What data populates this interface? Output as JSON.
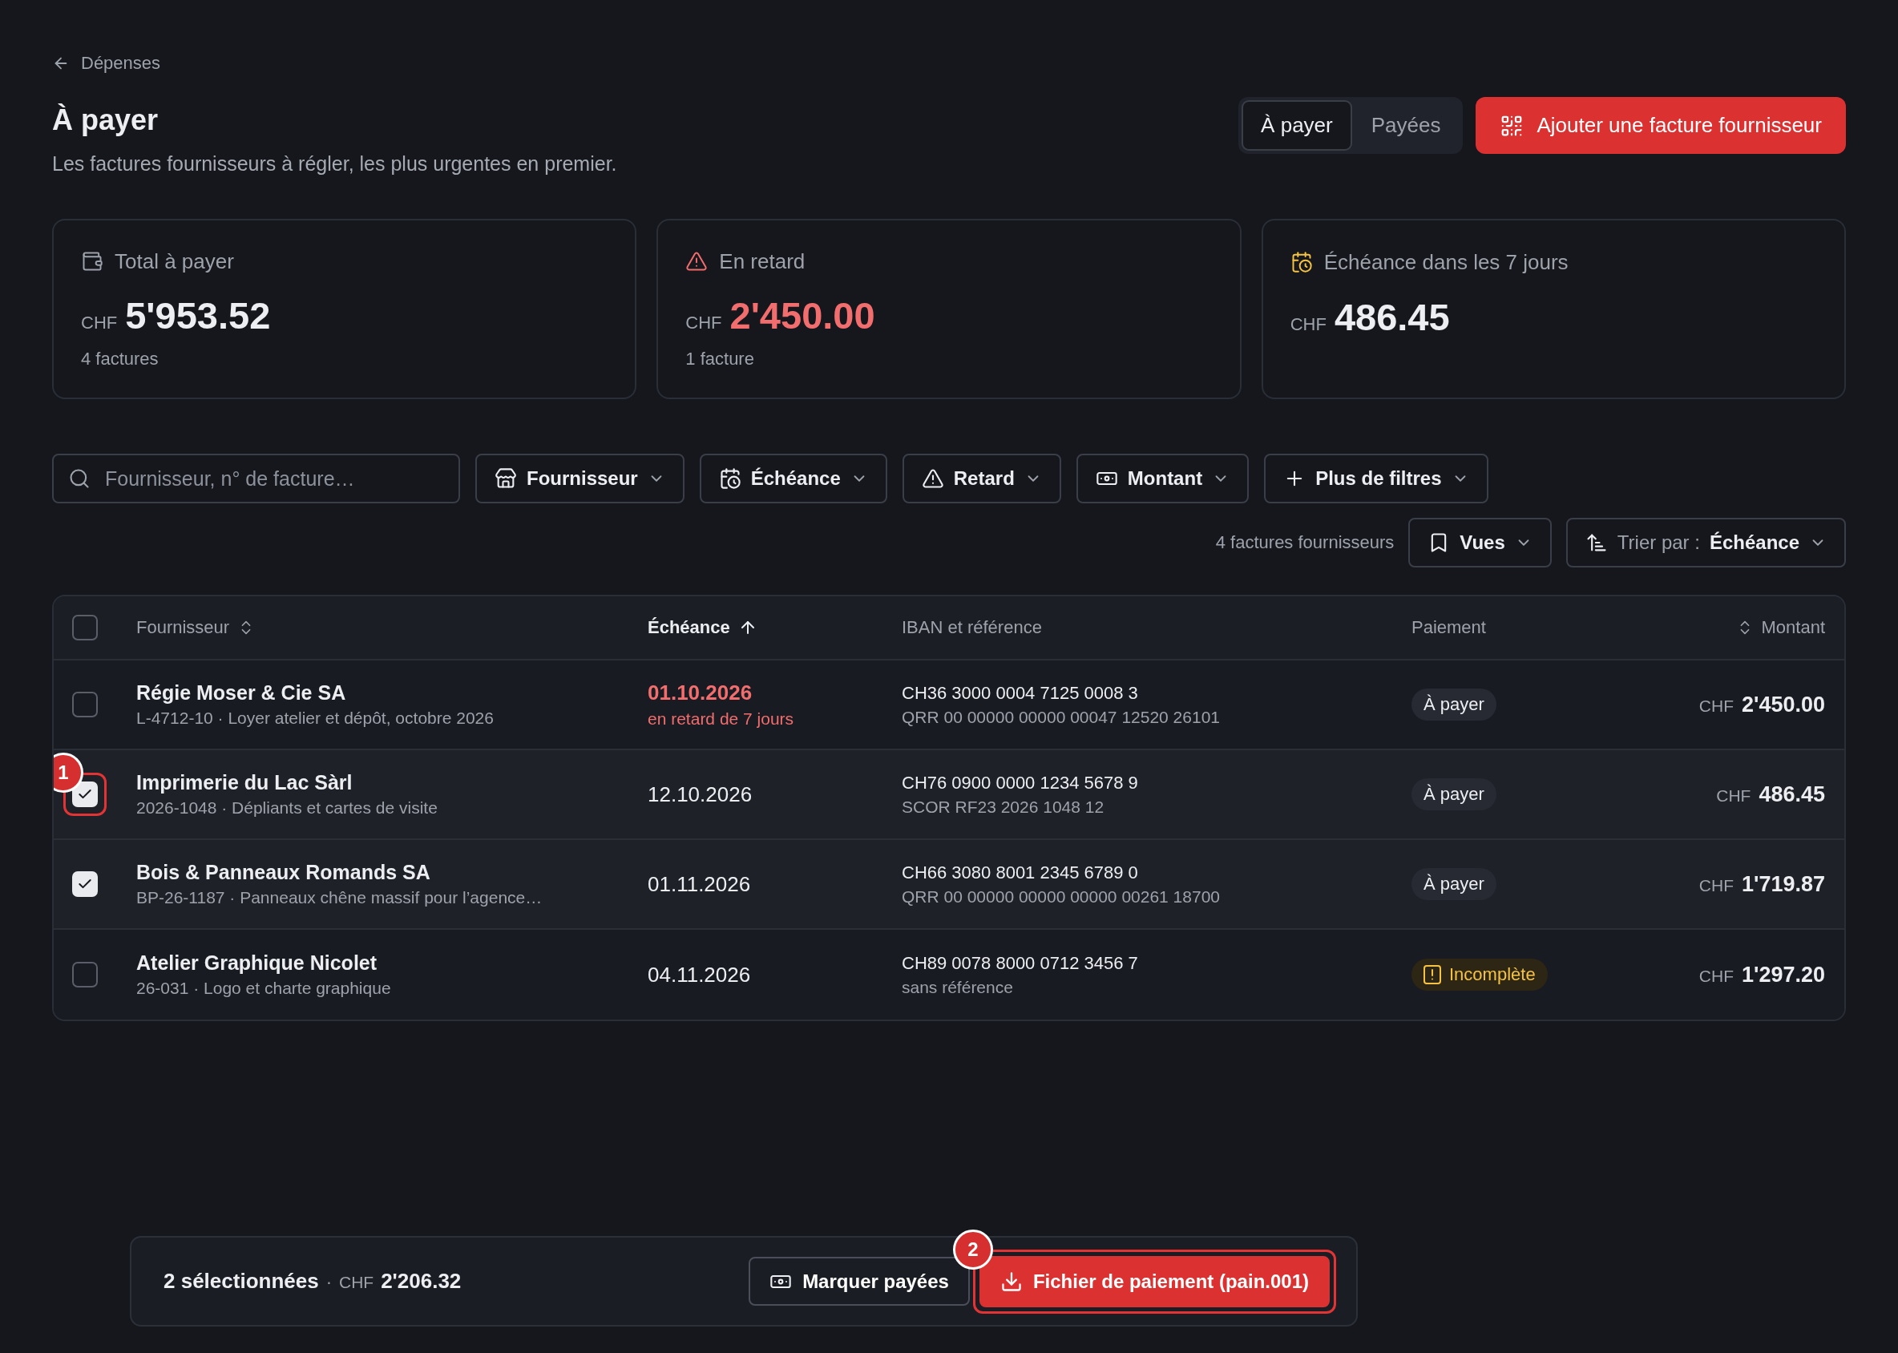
{
  "breadcrumb": {
    "label": "Dépenses"
  },
  "header": {
    "title": "À payer",
    "subtitle": "Les factures fournisseurs à régler, les plus urgentes en premier."
  },
  "view_tabs": [
    {
      "label": "À payer",
      "selected": true
    },
    {
      "label": "Payées",
      "selected": false
    }
  ],
  "primary_action": {
    "label": "Ajouter une facture fournisseur"
  },
  "stats": [
    {
      "kind": "total",
      "label": "Total à payer",
      "currency": "CHF",
      "value": "5'953.52",
      "note": "4 factures"
    },
    {
      "kind": "overdue",
      "label": "En retard",
      "currency": "CHF",
      "value": "2'450.00",
      "note": "1 facture"
    },
    {
      "kind": "due_soon",
      "label": "Échéance dans les 7 jours",
      "currency": "CHF",
      "value": "486.45"
    }
  ],
  "filters": {
    "search": {
      "placeholder": "Fournisseur, n° de facture…"
    },
    "dropdowns": [
      {
        "kind": "supplier",
        "label": "Fournisseur"
      },
      {
        "kind": "due_date",
        "label": "Échéance"
      },
      {
        "kind": "overdue",
        "label": "Retard"
      },
      {
        "kind": "amount",
        "label": "Montant"
      },
      {
        "kind": "more",
        "label": "Plus de filtres"
      }
    ]
  },
  "results": {
    "count": "4 factures fournisseurs",
    "views": {
      "label": "Vues"
    },
    "sort": {
      "label": "Trier par :",
      "value": "Échéance"
    }
  },
  "table": {
    "header_checkbox": {
      "checked": false
    },
    "columns": [
      {
        "label": "Fournisseur",
        "sortable": true,
        "sorted": false
      },
      {
        "label": "Échéance",
        "sortable": true,
        "sorted": true
      },
      {
        "label": "IBAN et référence",
        "sortable": false,
        "sorted": false
      },
      {
        "label": "Paiement",
        "sortable": false,
        "sorted": false
      },
      {
        "label": "Montant",
        "sortable": true,
        "sorted": false
      }
    ],
    "rows": [
      {
        "selected": false,
        "supplier": "Régie Moser & Cie SA",
        "details": "L-4712-10 · Loyer atelier et dépôt, octobre 2026",
        "due_date": "01.10.2026",
        "overdue": true,
        "overdue_note": "en retard de 7 jours",
        "iban": "CH36 3000 0004 7125 0008 3",
        "reference": "QRR 00 00000 00000 00047 12520 26101",
        "status": {
          "kind": "to_pay",
          "label": "À payer"
        },
        "currency": "CHF",
        "amount": "2'450.00"
      },
      {
        "selected": true,
        "callout": "1",
        "supplier": "Imprimerie du Lac Sàrl",
        "details": "2026-1048 · Dépliants et cartes de visite",
        "due_date": "12.10.2026",
        "overdue": false,
        "iban": "CH76 0900 0000 1234 5678 9",
        "reference": "SCOR RF23 2026 1048 12",
        "status": {
          "kind": "to_pay",
          "label": "À payer"
        },
        "currency": "CHF",
        "amount": "486.45"
      },
      {
        "selected": true,
        "supplier": "Bois & Panneaux Romands SA",
        "details": "BP-26-1187 · Panneaux chêne massif pour l’agence…",
        "due_date": "01.11.2026",
        "overdue": false,
        "iban": "CH66 3080 8001 2345 6789 0",
        "reference": "QRR 00 00000 00000 00000 00261 18700",
        "status": {
          "kind": "to_pay",
          "label": "À payer"
        },
        "currency": "CHF",
        "amount": "1'719.87"
      },
      {
        "selected": false,
        "supplier": "Atelier Graphique Nicolet",
        "details": "26-031 · Logo et charte graphique",
        "due_date": "04.11.2026",
        "overdue": false,
        "iban": "CH89 0078 8000 0712 3456 7",
        "reference": "sans référence",
        "status": {
          "kind": "incomplete",
          "label": "Incomplète"
        },
        "currency": "CHF",
        "amount": "1'297.20"
      }
    ]
  },
  "selection_bar": {
    "count": "2 sélectionnées",
    "separator": "·",
    "currency": "CHF",
    "amount": "2'206.32",
    "actions": [
      {
        "kind": "mark_paid",
        "label": "Marquer payées"
      },
      {
        "kind": "export",
        "label": "Fichier de paiement (pain.001)",
        "callout": "2"
      }
    ]
  }
}
